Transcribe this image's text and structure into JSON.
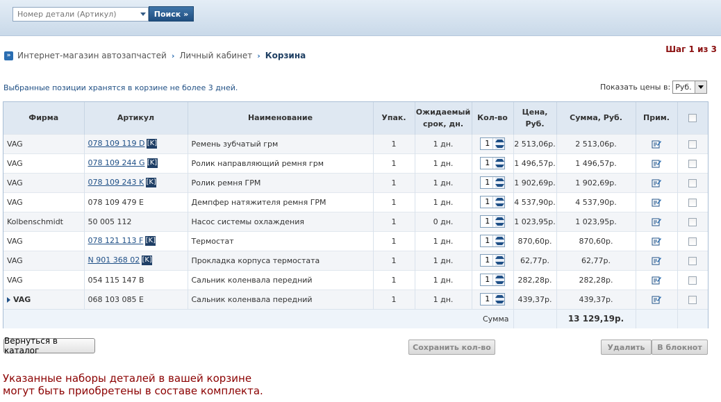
{
  "search": {
    "placeholder": "Номер детали (Артикул)",
    "button_label": "Поиск »"
  },
  "breadcrumb": {
    "items": [
      "Интернет-магазин автозапчастей",
      "Личный кабинет"
    ],
    "current": "Корзина"
  },
  "step": "Шаг 1 из 3",
  "note": "Выбранные позиции хранятся в корзине не более 3 дней.",
  "price_selector": {
    "label": "Показать цены в:",
    "value": "Руб."
  },
  "table": {
    "headers": {
      "firm": "Фирма",
      "article": "Артикул",
      "name": "Наименование",
      "pack": "Упак.",
      "term_1": "Ожидаемый",
      "term_2": "срок, дн.",
      "qty": "Кол-во",
      "price_1": "Цена,",
      "price_2": "Руб.",
      "sum": "Сумма, Руб.",
      "note": "Прим."
    },
    "rows": [
      {
        "firm": "VAG",
        "article": "078 109 119 D",
        "k": "[K]",
        "name": "Ремень зубчатый грм",
        "pack": "1",
        "term": "1 дн.",
        "qty": "1",
        "price": "2 513,06р.",
        "sum": "2 513,06р."
      },
      {
        "firm": "VAG",
        "article": "078 109 244 G",
        "k": "[K]",
        "name": "Ролик направляющий ремня грм",
        "pack": "1",
        "term": "1 дн.",
        "qty": "1",
        "price": "1 496,57р.",
        "sum": "1 496,57р."
      },
      {
        "firm": "VAG",
        "article": "078 109 243 K",
        "k": "[K]",
        "name": "Ролик ремня ГРМ",
        "pack": "1",
        "term": "1 дн.",
        "qty": "1",
        "price": "1 902,69р.",
        "sum": "1 902,69р."
      },
      {
        "firm": "VAG",
        "article": "078 109 479 E",
        "k": "",
        "name": "Демпфер натяжителя ремня ГРМ",
        "pack": "1",
        "term": "1 дн.",
        "qty": "1",
        "price": "4 537,90р.",
        "sum": "4 537,90р."
      },
      {
        "firm": "Kolbenschmidt",
        "article": "50 005 112",
        "k": "",
        "name": "Насос системы охлаждения",
        "pack": "1",
        "term": "0 дн.",
        "qty": "1",
        "price": "1 023,95р.",
        "sum": "1 023,95р."
      },
      {
        "firm": "VAG",
        "article": "078 121 113 F",
        "k": "[K]",
        "name": "Термостат",
        "pack": "1",
        "term": "1 дн.",
        "qty": "1",
        "price": "870,60р.",
        "sum": "870,60р."
      },
      {
        "firm": "VAG",
        "article": "N 901 368 02",
        "k": "[K]",
        "name": "Прокладка корпуса термостата",
        "pack": "1",
        "term": "1 дн.",
        "qty": "1",
        "price": "62,77р.",
        "sum": "62,77р."
      },
      {
        "firm": "VAG",
        "article": "054 115 147 B",
        "k": "",
        "name": "Сальник коленвала передний",
        "pack": "1",
        "term": "1 дн.",
        "qty": "1",
        "price": "282,28р.",
        "sum": "282,28р."
      },
      {
        "firm": "VAG",
        "article": "068 103 085 E",
        "k": "",
        "name": "Сальник коленвала передний",
        "pack": "1",
        "term": "1 дн.",
        "qty": "1",
        "price": "439,37р.",
        "sum": "439,37р."
      }
    ],
    "total_label": "Сумма",
    "total_value": "13 129,19р."
  },
  "buttons": {
    "back": "Вернуться в каталог",
    "save_qty": "Сохранить кол-во",
    "delete": "Удалить",
    "notebook": "В блокнот"
  },
  "promo": {
    "line1": "Указанные наборы деталей в вашей корзине",
    "line2": "могут быть приобретены в составе комплекта."
  },
  "colors": {
    "link": "#1e4f86",
    "accent_red": "#8b1010",
    "header_bg": "#dfe8f2",
    "badge": "#1f3f66"
  },
  "icons": {
    "note": "edit-note-icon",
    "breadcrumb": "double-arrow-icon"
  }
}
